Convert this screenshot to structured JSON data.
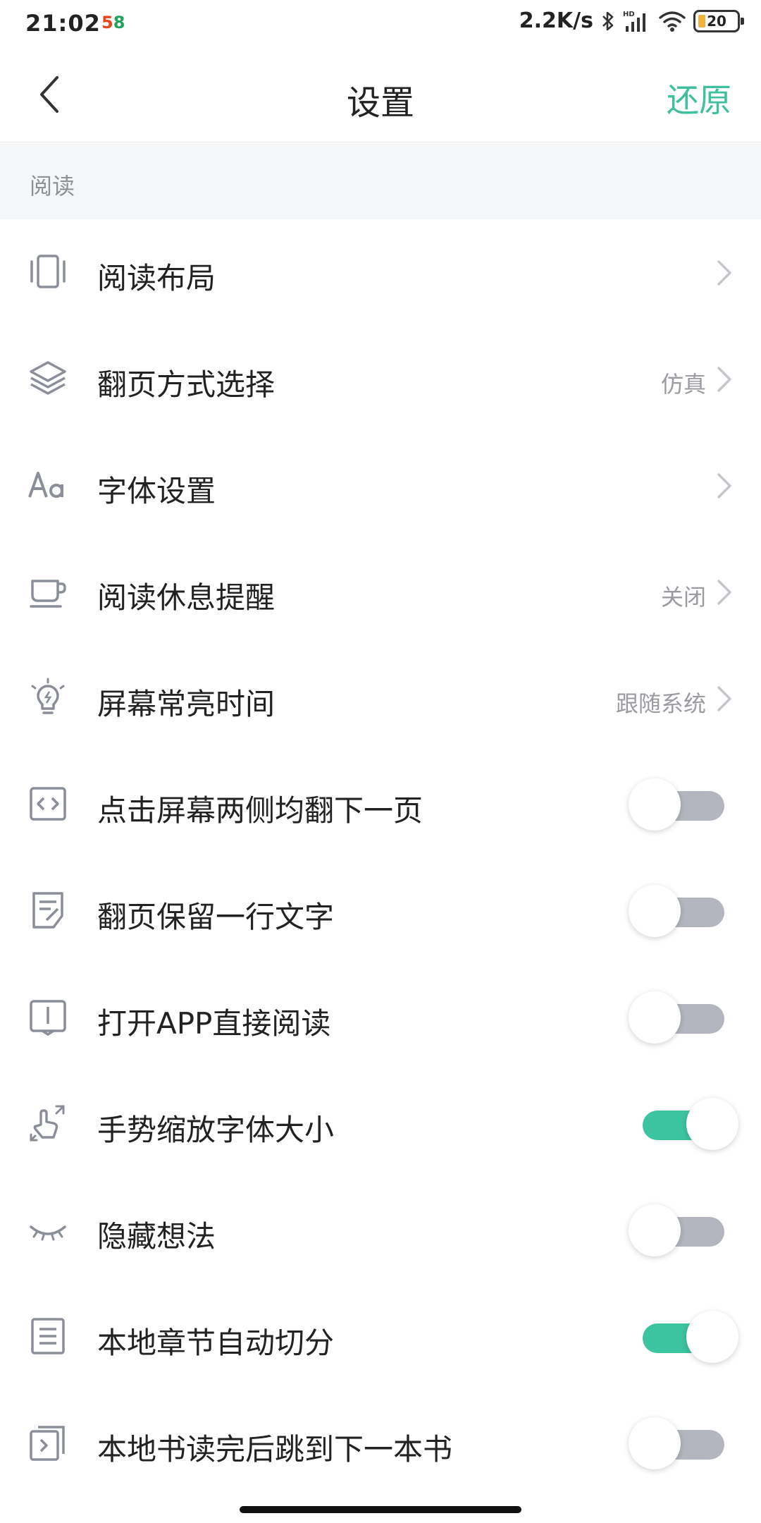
{
  "status_bar": {
    "time": "21:02",
    "app_badge": "58",
    "net_speed": "2.2K/s",
    "battery": "20",
    "hd_label": "HD"
  },
  "nav": {
    "title": "设置",
    "restore": "还原"
  },
  "section": {
    "title": "阅读"
  },
  "rows": [
    {
      "label": "阅读布局",
      "icon": "layout-icon",
      "type": "nav",
      "value": ""
    },
    {
      "label": "翻页方式选择",
      "icon": "layers-icon",
      "type": "nav",
      "value": "仿真"
    },
    {
      "label": "字体设置",
      "icon": "font-icon",
      "type": "nav",
      "value": ""
    },
    {
      "label": "阅读休息提醒",
      "icon": "cup-icon",
      "type": "nav",
      "value": "关闭"
    },
    {
      "label": "屏幕常亮时间",
      "icon": "bulb-icon",
      "type": "nav",
      "value": "跟随系统"
    },
    {
      "label": "点击屏幕两侧均翻下一页",
      "icon": "code-icon",
      "type": "toggle",
      "on": false
    },
    {
      "label": "翻页保留一行文字",
      "icon": "note-icon",
      "type": "toggle",
      "on": false
    },
    {
      "label": "打开APP直接阅读",
      "icon": "book-icon",
      "type": "toggle",
      "on": false
    },
    {
      "label": "手势缩放字体大小",
      "icon": "gesture-icon",
      "type": "toggle",
      "on": true
    },
    {
      "label": "隐藏想法",
      "icon": "eye-closed-icon",
      "type": "toggle",
      "on": false
    },
    {
      "label": "本地章节自动切分",
      "icon": "list-icon",
      "type": "toggle",
      "on": true
    },
    {
      "label": "本地书读完后跳到下一本书",
      "icon": "next-book-icon",
      "type": "toggle",
      "on": false
    }
  ],
  "colors": {
    "accent": "#3fbf9e",
    "toggle_on": "#3cc3a0",
    "toggle_off": "#b4b6bf",
    "section_bg": "#f5f6f8"
  }
}
